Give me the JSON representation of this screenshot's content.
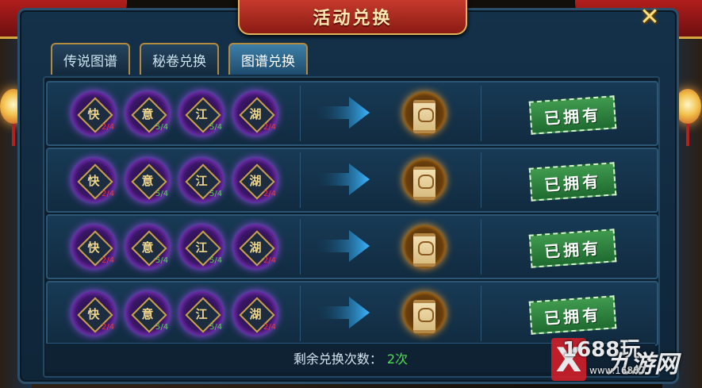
{
  "title": "活动兑换",
  "tabs": [
    {
      "label": "传说图谱",
      "active": false
    },
    {
      "label": "秘卷兑换",
      "active": false
    },
    {
      "label": "图谱兑换",
      "active": true
    }
  ],
  "rows": [
    {
      "orbs": [
        {
          "char": "快",
          "count": "2/4"
        },
        {
          "char": "意",
          "count": "5/4"
        },
        {
          "char": "江",
          "count": "5/4"
        },
        {
          "char": "湖",
          "count": "2/4"
        }
      ],
      "status": "已拥有"
    },
    {
      "orbs": [
        {
          "char": "快",
          "count": "2/4"
        },
        {
          "char": "意",
          "count": "5/4"
        },
        {
          "char": "江",
          "count": "5/4"
        },
        {
          "char": "湖",
          "count": "2/4"
        }
      ],
      "status": "已拥有"
    },
    {
      "orbs": [
        {
          "char": "快",
          "count": "2/4"
        },
        {
          "char": "意",
          "count": "5/4"
        },
        {
          "char": "江",
          "count": "5/4"
        },
        {
          "char": "湖",
          "count": "2/4"
        }
      ],
      "status": "已拥有"
    },
    {
      "orbs": [
        {
          "char": "快",
          "count": "2/4"
        },
        {
          "char": "意",
          "count": "5/4"
        },
        {
          "char": "江",
          "count": "5/4"
        },
        {
          "char": "湖",
          "count": "2/4"
        }
      ],
      "status": "已拥有"
    }
  ],
  "footer": {
    "label": "剩余兑换次数：",
    "value": "2次"
  },
  "watermark": {
    "t1": "1688玩",
    "t2": "九游网",
    "t3": "www.16887"
  },
  "colors": {
    "accent": "#d6a441",
    "owned": "#2e8a40",
    "insufficient": "#e23a3a",
    "sufficient": "#4fd44f"
  },
  "icons": {
    "close": "close-x-icon",
    "arrow": "right-arrow-icon",
    "reward": "scroll-icon"
  }
}
